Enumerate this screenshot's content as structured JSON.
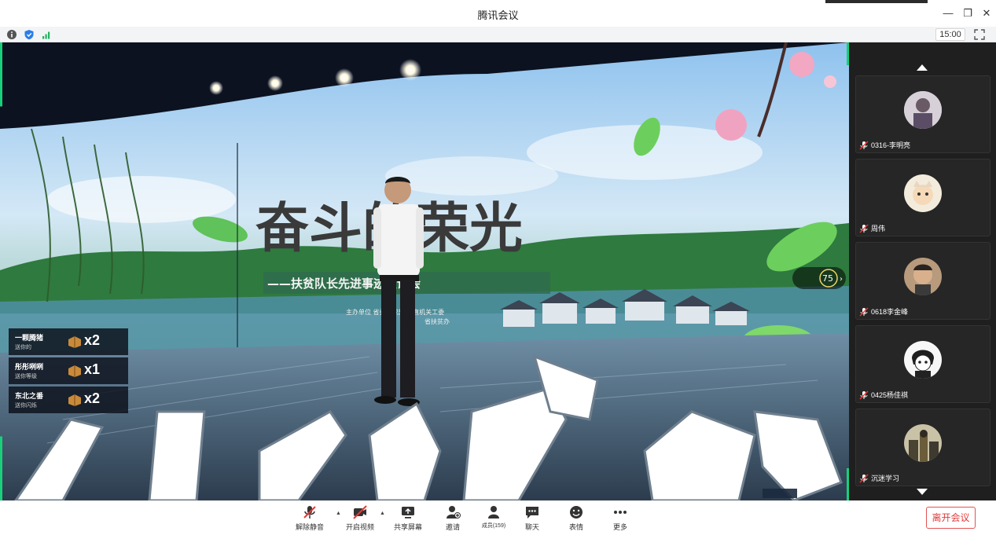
{
  "window": {
    "title": "腾讯会议"
  },
  "infobar": {
    "timer": "15:00"
  },
  "video": {
    "stage_title": "奋斗的荣光",
    "stage_subtitle": "——扶贫队长先进事迹宣讲会",
    "organizer_line1": "主办单位  省委组织部  省直机关工委",
    "organizer_line2": "省扶贫办",
    "viewer_badge": "75",
    "gifts": [
      {
        "name": "一颗腾猪",
        "sub": "送你的",
        "count": "x2"
      },
      {
        "name": "彤彤咧咧",
        "sub": "送你等级",
        "count": "x1"
      },
      {
        "name": "东北之番",
        "sub": "送你闪烁",
        "count": "x2"
      }
    ]
  },
  "participants": [
    {
      "name": "0316-李明亮"
    },
    {
      "name": "周伟"
    },
    {
      "name": "0618李金峰"
    },
    {
      "name": "0425杨佳祺"
    },
    {
      "name": "沉迷学习"
    }
  ],
  "toolbar": {
    "unmute": "解除静音",
    "start_video": "开启视频",
    "share_screen": "共享屏幕",
    "invite": "邀请",
    "members": "成员(159)",
    "chat": "聊天",
    "reactions": "表情",
    "more": "更多",
    "leave": "离开会议"
  },
  "colors": {
    "accent_green": "#18d07a",
    "leave_red": "#e03b3b",
    "sidebar_bg": "#1f1f1f"
  }
}
